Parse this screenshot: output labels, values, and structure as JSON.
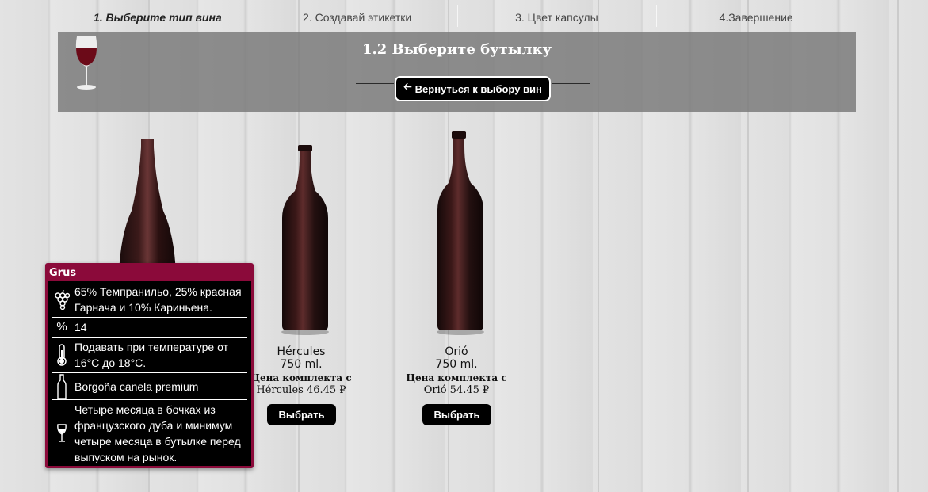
{
  "steps": [
    {
      "label": "1. Выберите тип вина",
      "active": true
    },
    {
      "label": "2. Создавай этикетки",
      "active": false
    },
    {
      "label": "3. Цвет капсулы",
      "active": false
    },
    {
      "label": "4.Завершение",
      "active": false
    }
  ],
  "header": {
    "title": "1.2 Выберите бутылку",
    "back_label": "Вернуться к выбору вин",
    "back_icon": "arrow-left-icon",
    "glass_icon": "wine-glass-icon"
  },
  "products": [
    {
      "name": "Hércules",
      "volume": "750 ml.",
      "price_line1": "Цена комплекта с",
      "price_line2": "Hércules 46.45 ₽",
      "button": "Выбрать"
    },
    {
      "name": "Orió",
      "volume": "750 ml.",
      "price_line1": "Цена комплекта с",
      "price_line2": "Orió 54.45 ₽",
      "button": "Выбрать"
    }
  ],
  "info": {
    "title": "Grus",
    "rows": [
      {
        "icon": "grapes-icon",
        "text": "65% Темпранильо, 25% красная Гарнача и 10% Кариньена."
      },
      {
        "icon": "percent-icon",
        "text": "14"
      },
      {
        "icon": "thermometer-icon",
        "text": "Подавать при температуре от 16°C до 18°C."
      },
      {
        "icon": "bottle-icon",
        "text": "Borgoña canela premium"
      },
      {
        "icon": "wine-glass-icon",
        "text": "Четыре месяца в бочках из французского дуба и минимум четыре месяца в бутылке перед выпуском на рынок."
      }
    ]
  },
  "colors": {
    "accent": "#8b0a3a",
    "button_bg": "#000000",
    "header_band": "#787878"
  }
}
